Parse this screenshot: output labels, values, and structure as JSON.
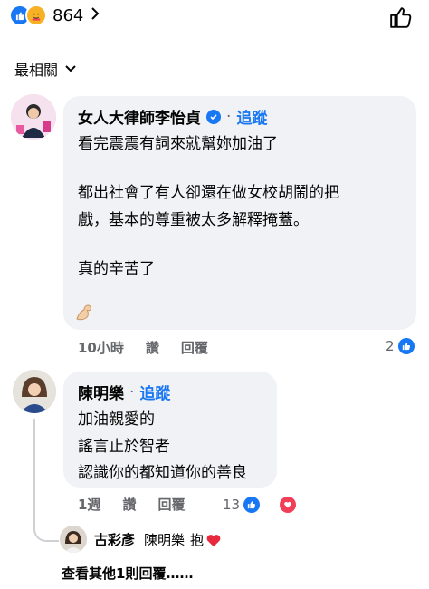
{
  "reactions": {
    "count": "864"
  },
  "sort": {
    "label": "最相關"
  },
  "comments": [
    {
      "author": "女人大律師李怡貞",
      "follow": "追蹤",
      "lines": [
        "看完震震有詞來就幫妳加油了",
        "都出社會了有人卻還在做女校胡鬧的把",
        "戲，基本的尊重被太多解釋掩蓋。",
        "真的辛苦了"
      ],
      "time": "10小時",
      "like_label": "讚",
      "reply_label": "回覆",
      "reaction_count": "2"
    },
    {
      "author": "陳明樂",
      "follow": "追蹤",
      "lines": [
        "加油親愛的",
        "謠言止於智者",
        "認識你的都知道你的善良"
      ],
      "time": "1週",
      "like_label": "讚",
      "reply_label": "回覆",
      "reaction_count": "13"
    }
  ],
  "reply_preview": {
    "author": "古彩彥",
    "mention": "陳明樂",
    "text": "抱"
  },
  "more_replies": "查看其他1則回覆……",
  "colors": {
    "accent": "#1877f2",
    "bubble": "#f0f2f5",
    "love": "#f33e58"
  }
}
